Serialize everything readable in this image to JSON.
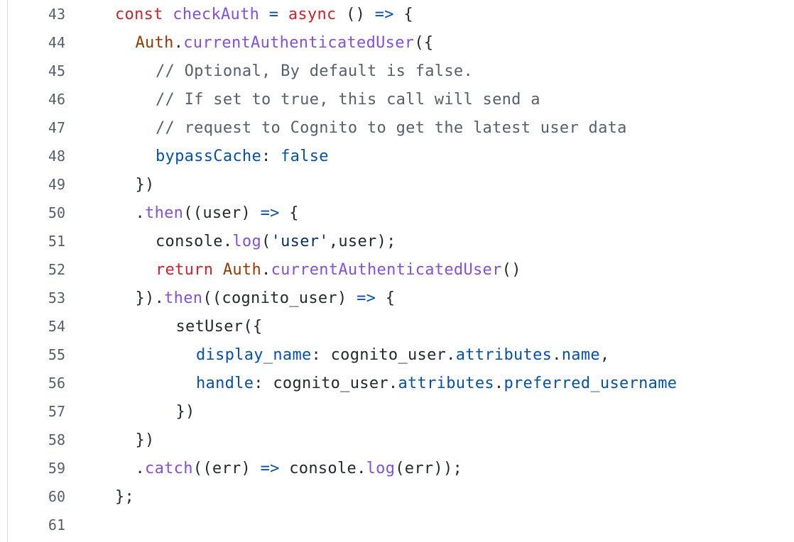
{
  "code_viewer": {
    "lines": [
      {
        "number": "43",
        "indent": 0,
        "tokens": [
          {
            "t": "const ",
            "c": "kw"
          },
          {
            "t": "checkAuth",
            "c": "fn"
          },
          {
            "t": " ",
            "c": "pl"
          },
          {
            "t": "=",
            "c": "prop"
          },
          {
            "t": " ",
            "c": "pl"
          },
          {
            "t": "async",
            "c": "kw"
          },
          {
            "t": " () ",
            "c": "pl"
          },
          {
            "t": "=>",
            "c": "prop"
          },
          {
            "t": " {",
            "c": "pl"
          }
        ]
      },
      {
        "number": "44",
        "indent": 1,
        "tokens": [
          {
            "t": "Auth",
            "c": "obj"
          },
          {
            "t": ".",
            "c": "pl"
          },
          {
            "t": "currentAuthenticatedUser",
            "c": "fn"
          },
          {
            "t": "({",
            "c": "pl"
          }
        ]
      },
      {
        "number": "45",
        "indent": 2,
        "tokens": [
          {
            "t": "// Optional, By default is false.",
            "c": "cmt"
          }
        ]
      },
      {
        "number": "46",
        "indent": 2,
        "tokens": [
          {
            "t": "// If set to true, this call will send a",
            "c": "cmt"
          }
        ]
      },
      {
        "number": "47",
        "indent": 2,
        "tokens": [
          {
            "t": "// request to Cognito to get the latest user data",
            "c": "cmt"
          }
        ]
      },
      {
        "number": "48",
        "indent": 2,
        "tokens": [
          {
            "t": "bypassCache",
            "c": "prop"
          },
          {
            "t": ": ",
            "c": "pl"
          },
          {
            "t": "false",
            "c": "prop"
          }
        ]
      },
      {
        "number": "49",
        "indent": 1,
        "tokens": [
          {
            "t": "})",
            "c": "pl"
          }
        ]
      },
      {
        "number": "50",
        "indent": 1,
        "tokens": [
          {
            "t": ".",
            "c": "pl"
          },
          {
            "t": "then",
            "c": "fn"
          },
          {
            "t": "((user) ",
            "c": "pl"
          },
          {
            "t": "=>",
            "c": "prop"
          },
          {
            "t": " {",
            "c": "pl"
          }
        ]
      },
      {
        "number": "51",
        "indent": 2,
        "tokens": [
          {
            "t": "console",
            "c": "pl"
          },
          {
            "t": ".",
            "c": "pl"
          },
          {
            "t": "log",
            "c": "fn"
          },
          {
            "t": "(",
            "c": "pl"
          },
          {
            "t": "'user'",
            "c": "str"
          },
          {
            "t": ",user);",
            "c": "pl"
          }
        ]
      },
      {
        "number": "52",
        "indent": 2,
        "tokens": [
          {
            "t": "return ",
            "c": "kw"
          },
          {
            "t": "Auth",
            "c": "obj"
          },
          {
            "t": ".",
            "c": "pl"
          },
          {
            "t": "currentAuthenticatedUser",
            "c": "fn"
          },
          {
            "t": "()",
            "c": "pl"
          }
        ]
      },
      {
        "number": "53",
        "indent": 1,
        "tokens": [
          {
            "t": "}).",
            "c": "pl"
          },
          {
            "t": "then",
            "c": "fn"
          },
          {
            "t": "((cognito_user) ",
            "c": "pl"
          },
          {
            "t": "=>",
            "c": "prop"
          },
          {
            "t": " {",
            "c": "pl"
          }
        ]
      },
      {
        "number": "54",
        "indent": 3,
        "tokens": [
          {
            "t": "setUser({",
            "c": "pl"
          }
        ]
      },
      {
        "number": "55",
        "indent": 4,
        "tokens": [
          {
            "t": "display_name",
            "c": "prop"
          },
          {
            "t": ": cognito_user.",
            "c": "pl"
          },
          {
            "t": "attributes",
            "c": "prop"
          },
          {
            "t": ".",
            "c": "pl"
          },
          {
            "t": "name",
            "c": "prop"
          },
          {
            "t": ",",
            "c": "pl"
          }
        ]
      },
      {
        "number": "56",
        "indent": 4,
        "tokens": [
          {
            "t": "handle",
            "c": "prop"
          },
          {
            "t": ": cognito_user.",
            "c": "pl"
          },
          {
            "t": "attributes",
            "c": "prop"
          },
          {
            "t": ".",
            "c": "pl"
          },
          {
            "t": "preferred_username",
            "c": "prop"
          }
        ]
      },
      {
        "number": "57",
        "indent": 3,
        "tokens": [
          {
            "t": "})",
            "c": "pl"
          }
        ]
      },
      {
        "number": "58",
        "indent": 1,
        "tokens": [
          {
            "t": "})",
            "c": "pl"
          }
        ]
      },
      {
        "number": "59",
        "indent": 1,
        "tokens": [
          {
            "t": ".",
            "c": "pl"
          },
          {
            "t": "catch",
            "c": "fn"
          },
          {
            "t": "((err) ",
            "c": "pl"
          },
          {
            "t": "=>",
            "c": "prop"
          },
          {
            "t": " console.",
            "c": "pl"
          },
          {
            "t": "log",
            "c": "fn"
          },
          {
            "t": "(err));",
            "c": "pl"
          }
        ]
      },
      {
        "number": "60",
        "indent": 0,
        "tokens": [
          {
            "t": "};",
            "c": "pl"
          }
        ]
      },
      {
        "number": "61",
        "indent": 0,
        "tokens": []
      }
    ]
  },
  "colors": {
    "keyword": "#cf222e",
    "function": "#8250df",
    "object": "#953800",
    "property": "#0550ae",
    "string": "#0a3069",
    "comment": "#57606a",
    "plain": "#24292f",
    "line_number": "#57606a",
    "background": "#ffffff"
  }
}
